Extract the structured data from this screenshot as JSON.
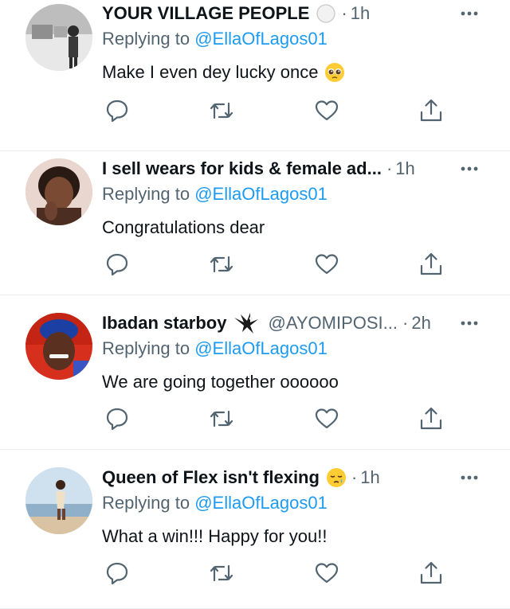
{
  "colors": {
    "text": "#0f1419",
    "secondary": "#536471",
    "link": "#1d9bf0",
    "divider": "#e6ecf0"
  },
  "replies": [
    {
      "name": "YOUR VILLAGE PEOPLE",
      "name_badge_icon": "white-circle-icon",
      "handle": "",
      "separator": "·",
      "time": "1h",
      "replying_prefix": "Replying to",
      "replying_to": "@EllaOfLagos01",
      "text": "Make I even dey lucky once",
      "text_emoji_icon": "pleading-face-emoji"
    },
    {
      "name": "I sell wears for kids & female ad...",
      "name_badge_icon": "",
      "handle": "",
      "separator": "·",
      "time": "1h",
      "replying_prefix": "Replying to",
      "replying_to": "@EllaOfLagos01",
      "text": "Congratulations dear",
      "text_emoji_icon": ""
    },
    {
      "name": "Ibadan starboy",
      "name_badge_icon": "eagle-icon",
      "handle": "@AYOMIPOSI...",
      "separator": "·",
      "time": "2h",
      "replying_prefix": "Replying to",
      "replying_to": "@EllaOfLagos01",
      "text": "We are going together oooooo",
      "text_emoji_icon": ""
    },
    {
      "name": "Queen of Flex isn't flexing",
      "name_badge_icon": "sleepy-face-emoji",
      "handle": "",
      "separator": "·",
      "time": "1h",
      "replying_prefix": "Replying to",
      "replying_to": "@EllaOfLagos01",
      "text": "What a win!!! Happy for you!!",
      "text_emoji_icon": ""
    }
  ],
  "action_icons": [
    "reply-icon",
    "retweet-icon",
    "like-icon",
    "share-icon"
  ]
}
